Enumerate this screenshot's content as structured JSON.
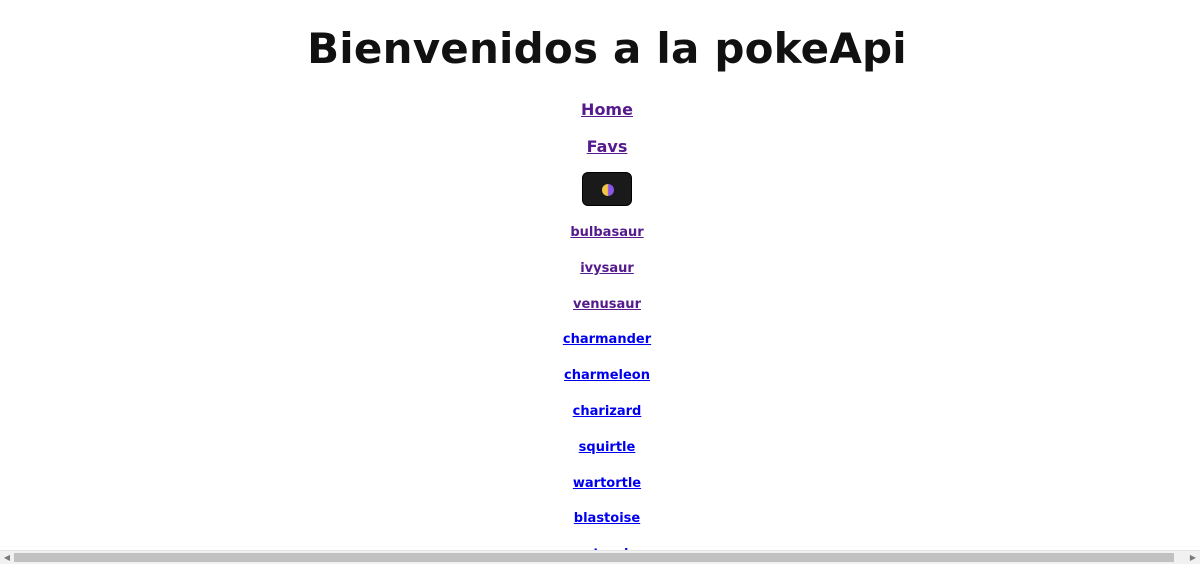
{
  "header": {
    "title": "Bienvenidos a la pokeApi"
  },
  "nav": {
    "home_label": "Home",
    "favs_label": "Favs"
  },
  "theme_toggle": {
    "icon": "moon-icon",
    "colors": [
      "#f4c542",
      "#8a55e8"
    ]
  },
  "pokemon": {
    "items": [
      {
        "name": "bulbasaur",
        "visited": true
      },
      {
        "name": "ivysaur",
        "visited": true
      },
      {
        "name": "venusaur",
        "visited": true
      },
      {
        "name": "charmander",
        "visited": false
      },
      {
        "name": "charmeleon",
        "visited": false
      },
      {
        "name": "charizard",
        "visited": false
      },
      {
        "name": "squirtle",
        "visited": false
      },
      {
        "name": "wartortle",
        "visited": false
      },
      {
        "name": "blastoise",
        "visited": false
      },
      {
        "name": "caterpie",
        "visited": false
      }
    ]
  },
  "colors": {
    "link": "#0000ee",
    "visited_link": "#551a8b",
    "toggle_bg": "#1a1a1a"
  }
}
